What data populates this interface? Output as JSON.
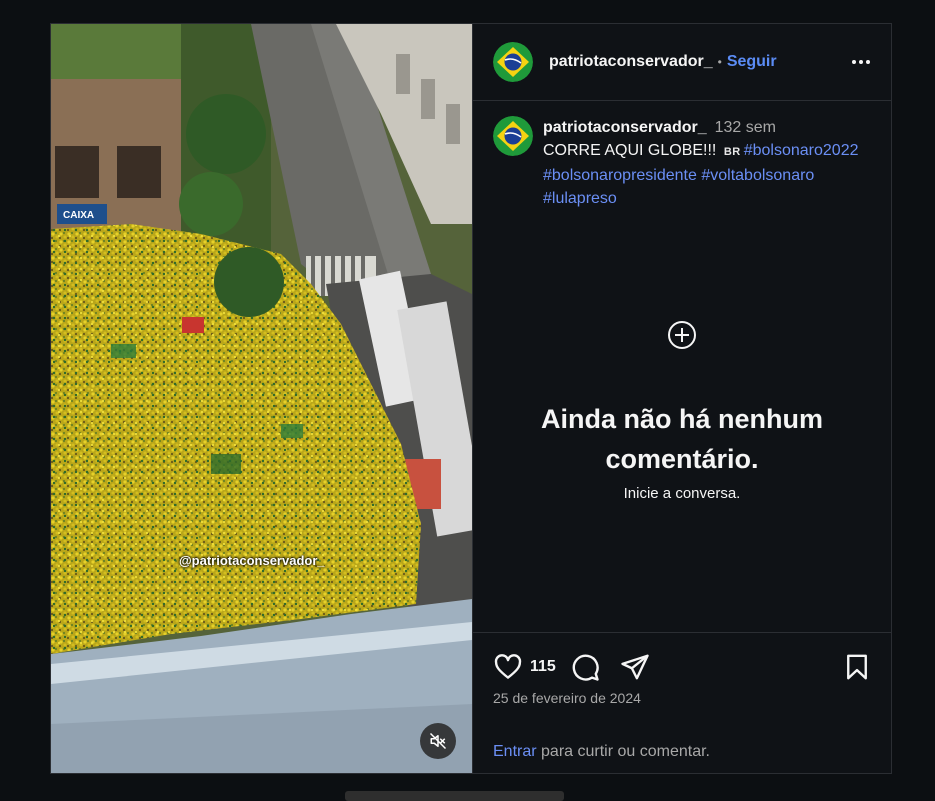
{
  "post": {
    "username": "patriotaconservador_",
    "separator": "•",
    "follow_label": "Seguir",
    "caption_time": "132 sem",
    "caption_text": "CORRE AQUI GLOBE!!!",
    "caption_flag": "BR",
    "hashtags": [
      "#bolsonaro2022",
      "#bolsonaropresidente",
      "#voltabolsonaro",
      "#lulapreso"
    ],
    "empty_title": "Ainda não há nenhum comentário.",
    "empty_subtitle": "Inicie a conversa.",
    "like_count": "115",
    "date": "25 de fevereiro de 2024",
    "login_link": "Entrar",
    "login_text": " para curtir ou comentar."
  },
  "media": {
    "watermark": "@patriotaconservador_",
    "building_sign": "CAIXA"
  },
  "icons": {
    "more": "more-horizontal-icon",
    "add_comment": "plus-circle-icon",
    "like": "heart-icon",
    "comment": "comment-bubble-icon",
    "share": "send-icon",
    "save": "bookmark-icon",
    "mute": "speaker-muted-icon"
  },
  "colors": {
    "link_blue": "#6b8ff5",
    "background": "#0f1216",
    "crowd_yellow": "#d8c21e",
    "crowd_green": "#3d7a2c"
  }
}
